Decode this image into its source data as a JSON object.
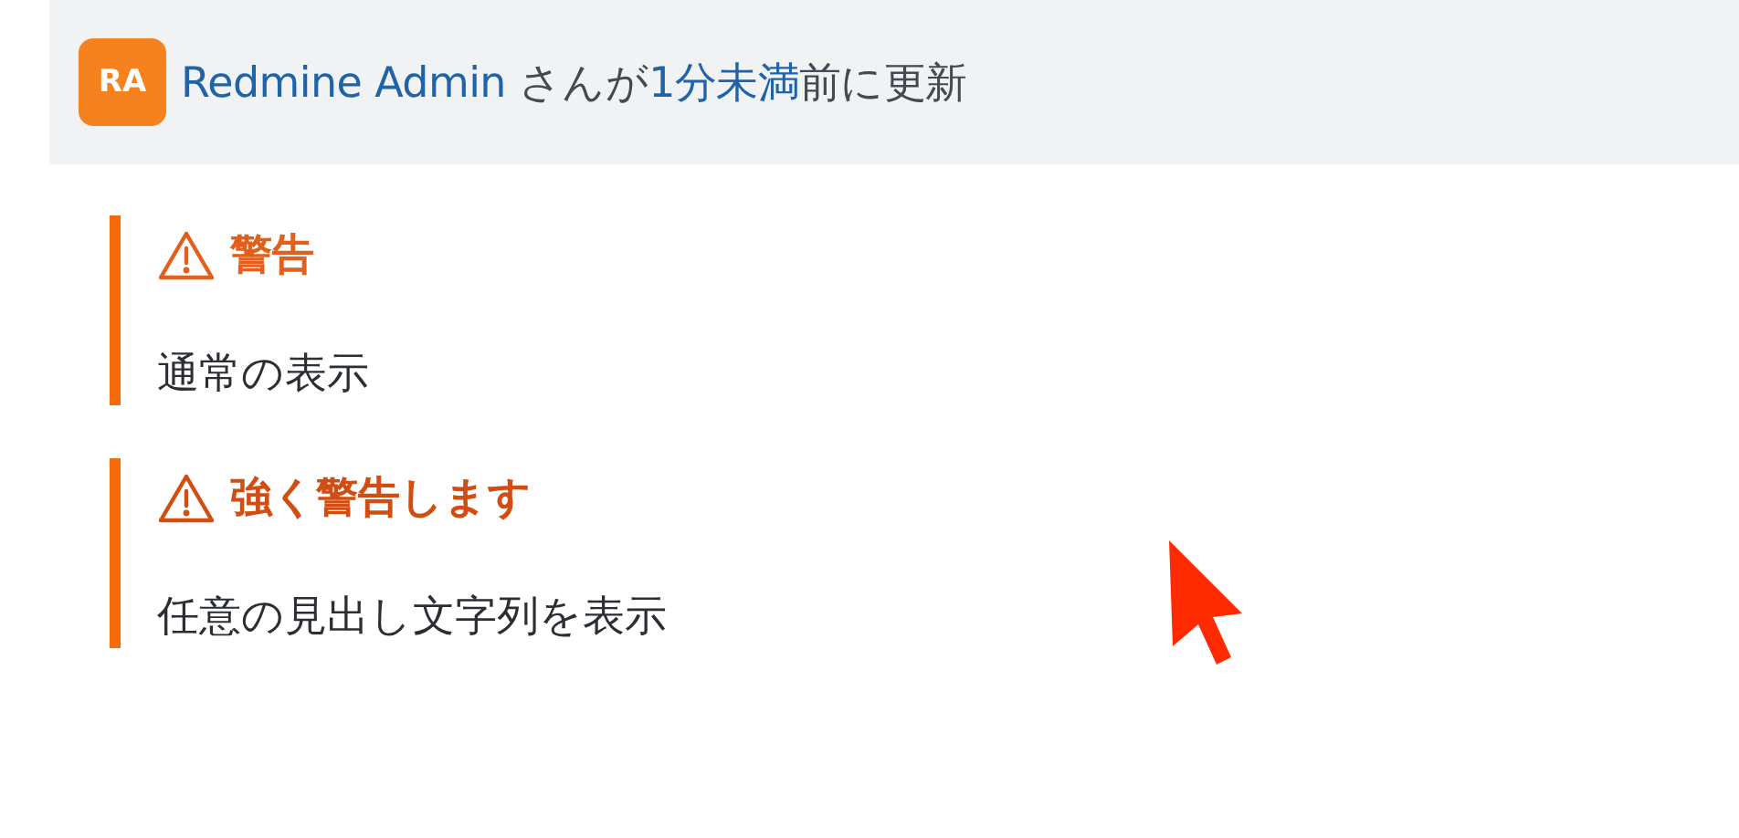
{
  "header": {
    "avatar": "RA",
    "author": "Redmine Admin",
    "text_1": " さんが",
    "time": "1分未満",
    "text_2": "前に更新"
  },
  "alerts": [
    {
      "title": "警告",
      "body": "通常の表示",
      "color": "#e0601c"
    },
    {
      "title": "強く警告します",
      "body": "任意の見出し文字列を表示",
      "color": "#d24d12"
    }
  ]
}
